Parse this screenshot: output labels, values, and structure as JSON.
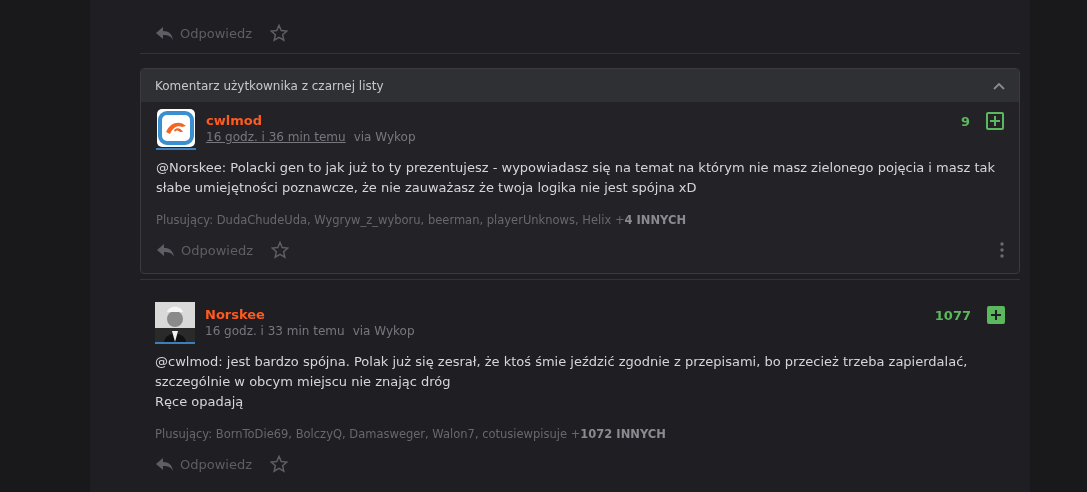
{
  "previous_comment": {
    "reply": "Odpowiedz",
    "favorite": false
  },
  "comments": [
    {
      "blacklisted": true,
      "blacklist_label": "Komentarz użytkownika z czarnej listy",
      "avatar": {
        "kind": "logo"
      },
      "author": "cwlmod",
      "time": "16 godz. i 36 min temu",
      "time_underlined": true,
      "via": "via Wykop",
      "votes": "9",
      "voted": false,
      "text": [
        "@Norskee: Polacki gen to jak już to ty prezentujesz - wypowiadasz się na temat na którym nie masz zielonego pojęcia i masz tak słabe umiejętności poznawcze, że nie zauważasz że twoja logika nie jest spójna xD"
      ],
      "plus": "Plusujący: DudaChudeUda, Wygryw_z_wyboru, beerman, playerUnknows, Helix +**4 INNYCH**",
      "reply": "Odpowiedz",
      "favorite": false,
      "more_menu": true
    },
    {
      "blacklisted": false,
      "author": "Norskee",
      "time": "16 godz. i 33 min temu",
      "time_underlined": false,
      "via": "via Wykop",
      "votes": "1077",
      "voted": true,
      "text": [
        "@cwlmod: jest bardzo spójna. Polak już się zesrał, że ktoś śmie jeździć zgodnie z przepisami, bo przecież trzeba zapierdalać, szczególnie w obcym miejscu nie znając dróg",
        "Ręce opadają"
      ],
      "plus": "Plusujący: BornToDie69, BolczyQ, Damasweger, Walon7, cotusiewpisuje +**1072 INNYCH**",
      "reply": "Odpowiedz",
      "favorite": false,
      "more_menu": false
    }
  ]
}
